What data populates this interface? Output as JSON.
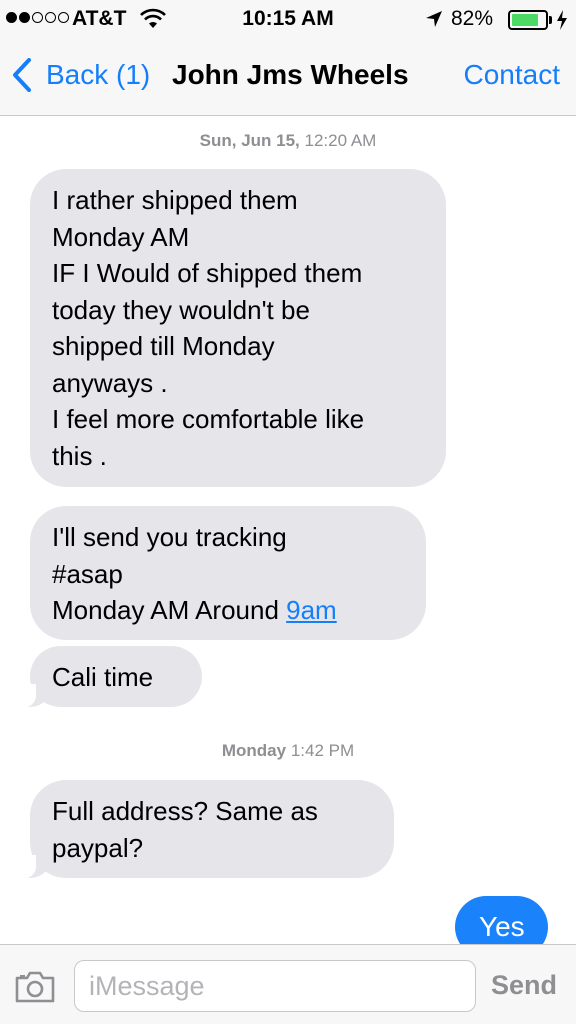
{
  "status_bar": {
    "carrier": "AT&T",
    "time": "10:15 AM",
    "battery_percent": "82%",
    "battery_level": 0.82,
    "signal_bars_filled": 2,
    "signal_bars_total": 5,
    "charging": true
  },
  "nav": {
    "back_label": "Back (1)",
    "title": "John Jms Wheels",
    "contact_label": "Contact"
  },
  "conversation": {
    "timestamp_1": {
      "day": "Sun, Jun 15,",
      "time": "12:20 AM"
    },
    "message_1": "I rather shipped them\nMonday AM\nIF I Would of shipped them\ntoday they wouldn't be\nshipped till Monday\nanyways .\nI feel more comfortable like\nthis .",
    "message_2_text": "I'll send you tracking\n#asap\nMonday AM Around ",
    "message_2_link": "9am",
    "message_3": "Cali time",
    "timestamp_2": {
      "day": "Monday",
      "time": "1:42 PM"
    },
    "message_4": "Full address? Same as\npaypal?",
    "message_5_outgoing": "Yes"
  },
  "input_bar": {
    "placeholder": "iMessage",
    "value": "",
    "send_label": "Send"
  },
  "colors": {
    "accent": "#147efb",
    "incoming_bubble": "#e5e5ea",
    "outgoing_bubble": "#1a83fb",
    "battery": "#4cd964"
  },
  "icons": [
    "signal-dots-icon",
    "wifi-icon",
    "location-arrow-icon",
    "battery-icon",
    "charging-bolt-icon",
    "chevron-left-icon",
    "camera-icon"
  ]
}
